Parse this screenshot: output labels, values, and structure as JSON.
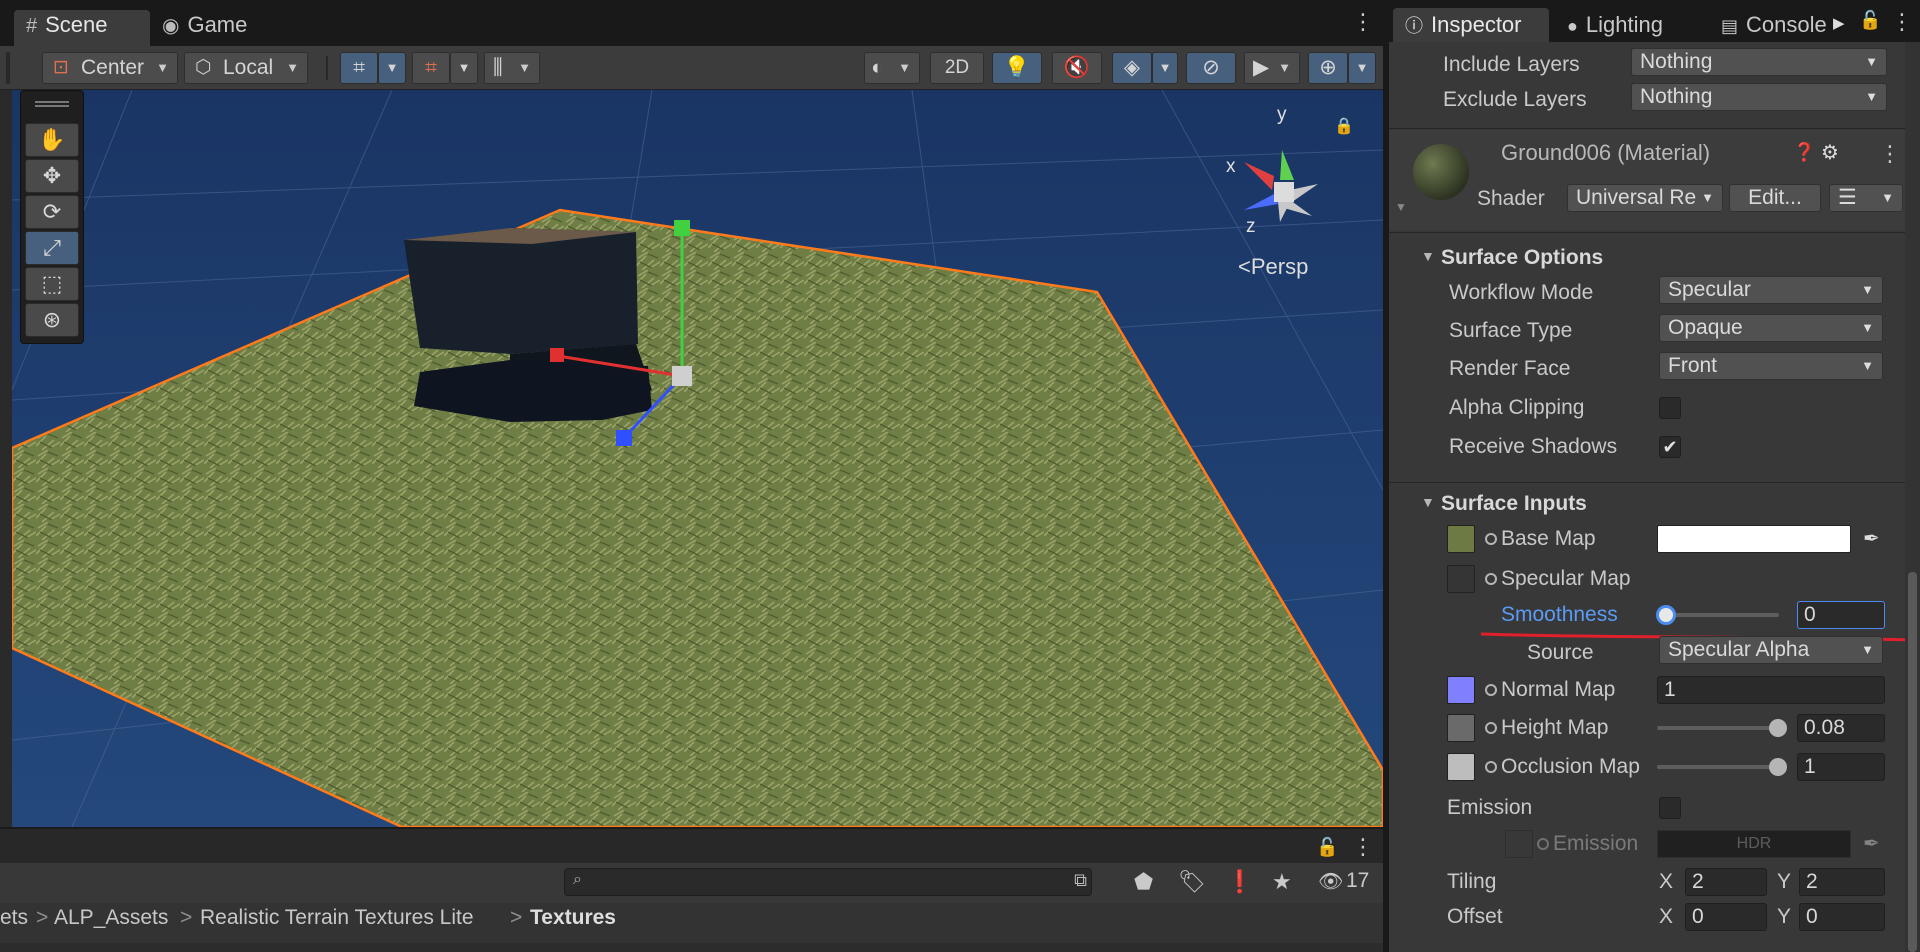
{
  "scene_tabs": {
    "scene_label": "Scene",
    "game_label": "Game"
  },
  "scene_toolbar": {
    "pivot_label": "Center",
    "space_label": "Local",
    "mode_2d_label": "2D"
  },
  "viewport": {
    "persp_label": "Persp",
    "axis_x": "x",
    "axis_y": "y",
    "axis_z": "z",
    "colors": {
      "sky": "#1e3d6e",
      "grass": "#7a8a4a",
      "selection_outline": "#ff7a1a",
      "gizmo_x": "#e03030",
      "gizmo_y": "#40d040",
      "gizmo_z": "#3050ff"
    }
  },
  "scene_tools": [
    "hand-tool",
    "move-tool",
    "rotate-tool",
    "scale-tool",
    "rect-tool",
    "transform-tool"
  ],
  "project": {
    "search_placeholder": "",
    "hidden_count": "17",
    "breadcrumb": [
      "ets",
      "ALP_Assets",
      "Realistic Terrain Textures Lite",
      "Textures"
    ]
  },
  "inspector": {
    "tabs": {
      "inspector": "Inspector",
      "lighting": "Lighting",
      "console": "Console"
    },
    "include_layers": {
      "label": "Include Layers",
      "value": "Nothing"
    },
    "exclude_layers": {
      "label": "Exclude Layers",
      "value": "Nothing"
    },
    "material": {
      "name": "Ground006 (Material)",
      "shader_label": "Shader",
      "shader_value": "Universal Re",
      "edit_label": "Edit..."
    },
    "surface_options": {
      "title": "Surface Options",
      "workflow_mode": {
        "label": "Workflow Mode",
        "value": "Specular"
      },
      "surface_type": {
        "label": "Surface Type",
        "value": "Opaque"
      },
      "render_face": {
        "label": "Render Face",
        "value": "Front"
      },
      "alpha_clipping": {
        "label": "Alpha Clipping",
        "checked": false
      },
      "receive_shadows": {
        "label": "Receive Shadows",
        "checked": true,
        "mark": "✔"
      }
    },
    "surface_inputs": {
      "title": "Surface Inputs",
      "base_map": {
        "label": "Base Map",
        "color": "#ffffff"
      },
      "specular_map": {
        "label": "Specular Map"
      },
      "smoothness": {
        "label": "Smoothness",
        "value": "0",
        "level": 0
      },
      "source": {
        "label": "Source",
        "value": "Specular Alpha"
      },
      "normal_map": {
        "label": "Normal Map",
        "value": "1"
      },
      "height_map": {
        "label": "Height Map",
        "value": "0.08",
        "level": 1
      },
      "occlusion_map": {
        "label": "Occlusion Map",
        "value": "1",
        "level": 1
      },
      "emission": {
        "label": "Emission",
        "checked": false
      },
      "emission_map": {
        "label": "Emission Map",
        "hdr_label": "HDR"
      },
      "tiling": {
        "label": "Tiling",
        "x_label": "X",
        "x": "2",
        "y_label": "Y",
        "y": "2"
      },
      "offset": {
        "label": "Offset",
        "x_label": "X",
        "x": "0",
        "y_label": "Y",
        "y": "0"
      }
    },
    "annotation_color": "#e0202a"
  }
}
